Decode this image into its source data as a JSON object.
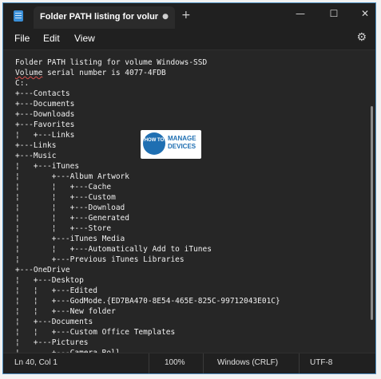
{
  "window": {
    "tab_title": "Folder PATH listing for volume W",
    "tab_close_icon": "close-icon",
    "new_tab_icon": "plus-icon",
    "controls": [
      "minimize-icon",
      "maximize-icon",
      "close-icon"
    ]
  },
  "menu": {
    "file": "File",
    "edit": "Edit",
    "view": "View",
    "settings_icon": "gear-icon"
  },
  "editor": {
    "lines": [
      "Folder PATH listing for volume Windows-SSD",
      "Volume serial number is 4077-4FDB",
      "C:.",
      "+---Contacts",
      "+---Documents",
      "+---Downloads",
      "+---Favorites",
      "¦   +---Links",
      "+---Links",
      "+---Music",
      "¦   +---iTunes",
      "¦       +---Album Artwork",
      "¦       ¦   +---Cache",
      "¦       ¦   +---Custom",
      "¦       ¦   +---Download",
      "¦       ¦   +---Generated",
      "¦       ¦   +---Store",
      "¦       +---iTunes Media",
      "¦       ¦   +---Automatically Add to iTunes",
      "¦       +---Previous iTunes Libraries",
      "+---OneDrive",
      "¦   +---Desktop",
      "¦   ¦   +---Edited",
      "¦   ¦   +---GodMode.{ED7BA470-8E54-465E-825C-99712043E01C}",
      "¦   ¦   +---New folder",
      "¦   +---Documents",
      "¦   ¦   +---Custom Office Templates",
      "¦   +---Pictures",
      "¦       +---Camera Roll"
    ],
    "watermark": {
      "mark_text": "HOW TO",
      "word1": "MANAGE",
      "word2": "DEVICES"
    }
  },
  "status": {
    "position": "Ln 40, Col 1",
    "zoom": "100%",
    "line_ending": "Windows (CRLF)",
    "encoding": "UTF-8"
  }
}
